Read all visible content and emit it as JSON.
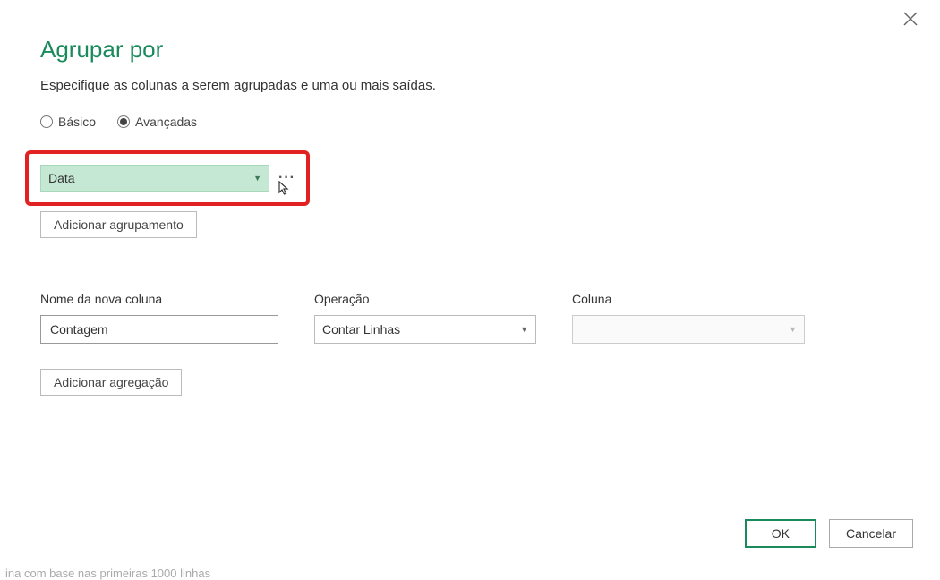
{
  "dialog": {
    "title": "Agrupar por",
    "subtitle": "Especifique as colunas a serem agrupadas e uma ou mais saídas.",
    "radio": {
      "basic": "Básico",
      "advanced": "Avançadas",
      "selected": "advanced"
    },
    "grouping": {
      "selected_column": "Data",
      "add_grouping": "Adicionar agrupamento"
    },
    "aggregation": {
      "new_column_label": "Nome da nova coluna",
      "new_column_value": "Contagem",
      "operation_label": "Operação",
      "operation_value": "Contar Linhas",
      "column_label": "Coluna",
      "column_value": "",
      "add_aggregation": "Adicionar agregação"
    },
    "buttons": {
      "ok": "OK",
      "cancel": "Cancelar"
    }
  },
  "bottom_text": "ina com base nas primeiras 1000 linhas"
}
